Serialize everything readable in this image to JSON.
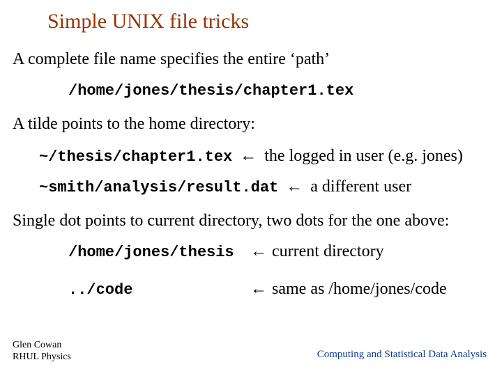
{
  "title": "Simple UNIX file tricks",
  "para1": "A complete file name specifies the entire ‘path’",
  "code1": "/home/jones/thesis/chapter1.tex",
  "para2": "A tilde points to the home directory:",
  "tilde_ex1_code": "~/thesis/chapter1.tex",
  "arrow": "←",
  "tilde_ex1_desc": "the logged in user (e.g. jones)",
  "tilde_ex2_code": "~smith/analysis/result.dat",
  "tilde_ex2_desc": "a different user",
  "para3": "Single dot points to current directory, two dots for the one above:",
  "dot_ex1_code": "/home/jones/thesis",
  "dot_ex1_desc": "current directory",
  "dot_ex2_code": "../code",
  "dot_ex2_desc": "same as /home/jones/code",
  "footer_author": "Glen Cowan",
  "footer_affil": "RHUL Physics",
  "footer_course": "Computing and Statistical Data Analysis"
}
